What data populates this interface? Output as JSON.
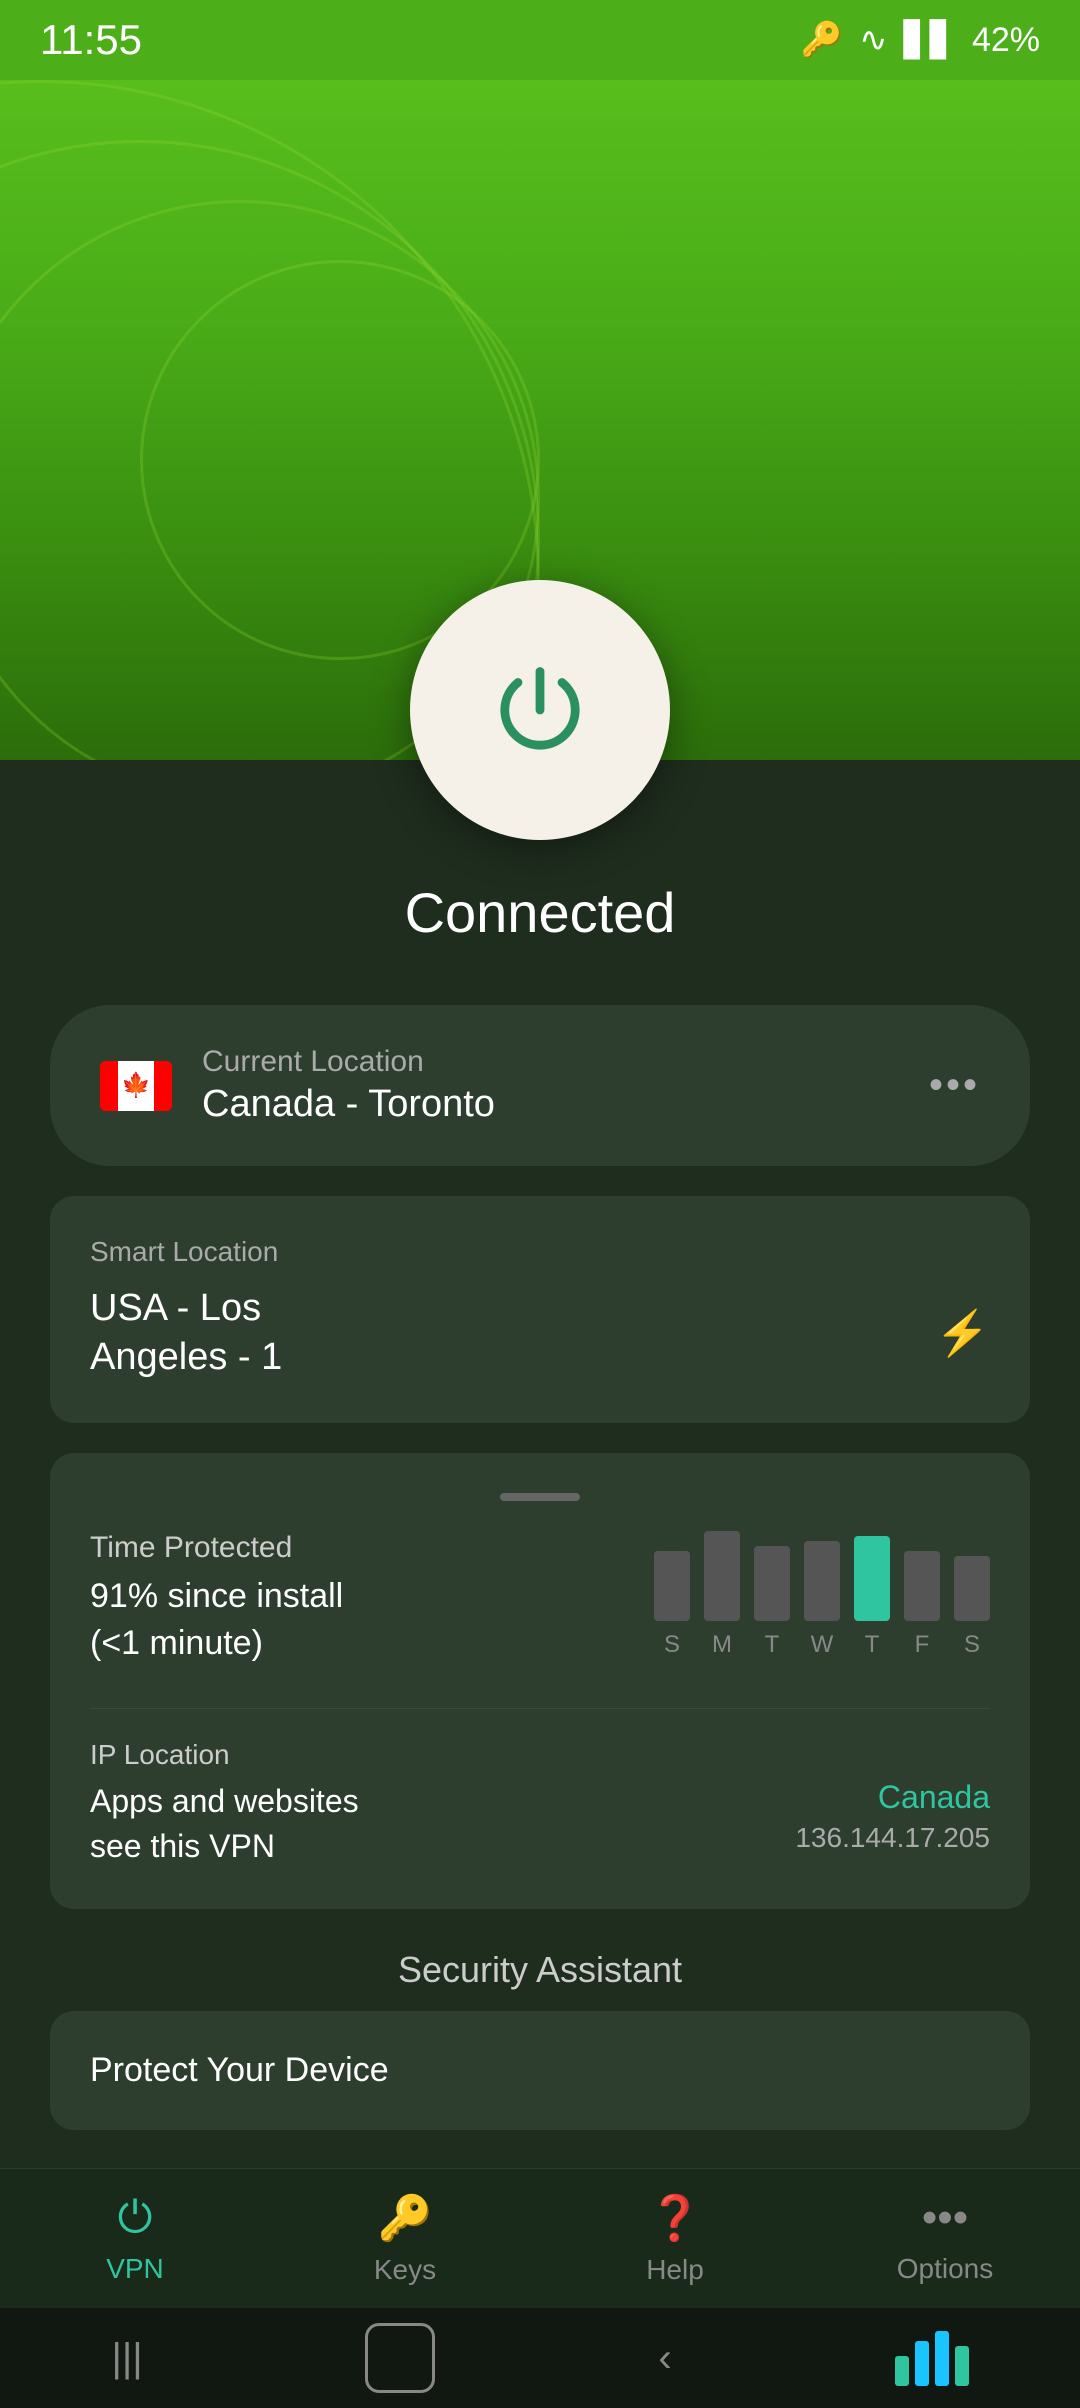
{
  "statusBar": {
    "time": "11:55",
    "battery": "42%"
  },
  "hero": {
    "status": "Connected"
  },
  "currentLocation": {
    "label": "Current Location",
    "name": "Canada - Toronto",
    "flagEmoji": "🍁"
  },
  "smartLocation": {
    "label": "Smart Location",
    "name": "USA - Los Angeles - 1"
  },
  "timeProtected": {
    "label": "Time Protected",
    "value": "91% since install\n(<1 minute)",
    "line1": "91% since install",
    "line2": "(<1 minute)",
    "days": [
      "S",
      "M",
      "T",
      "W",
      "T",
      "F",
      "S"
    ],
    "activeDay": 4
  },
  "ipLocation": {
    "label": "IP Location",
    "description": "Apps and websites\nsee this VPN",
    "line1": "Apps and websites",
    "line2": "see this VPN",
    "country": "Canada",
    "ip": "136.144.17.205"
  },
  "securityAssistant": {
    "title": "Security Assistant",
    "protectTitle": "Protect Your Device"
  },
  "bottomNav": {
    "items": [
      {
        "id": "vpn",
        "label": "VPN",
        "active": true
      },
      {
        "id": "keys",
        "label": "Keys",
        "active": false
      },
      {
        "id": "help",
        "label": "Help",
        "active": false
      },
      {
        "id": "options",
        "label": "Options",
        "active": false
      }
    ]
  }
}
